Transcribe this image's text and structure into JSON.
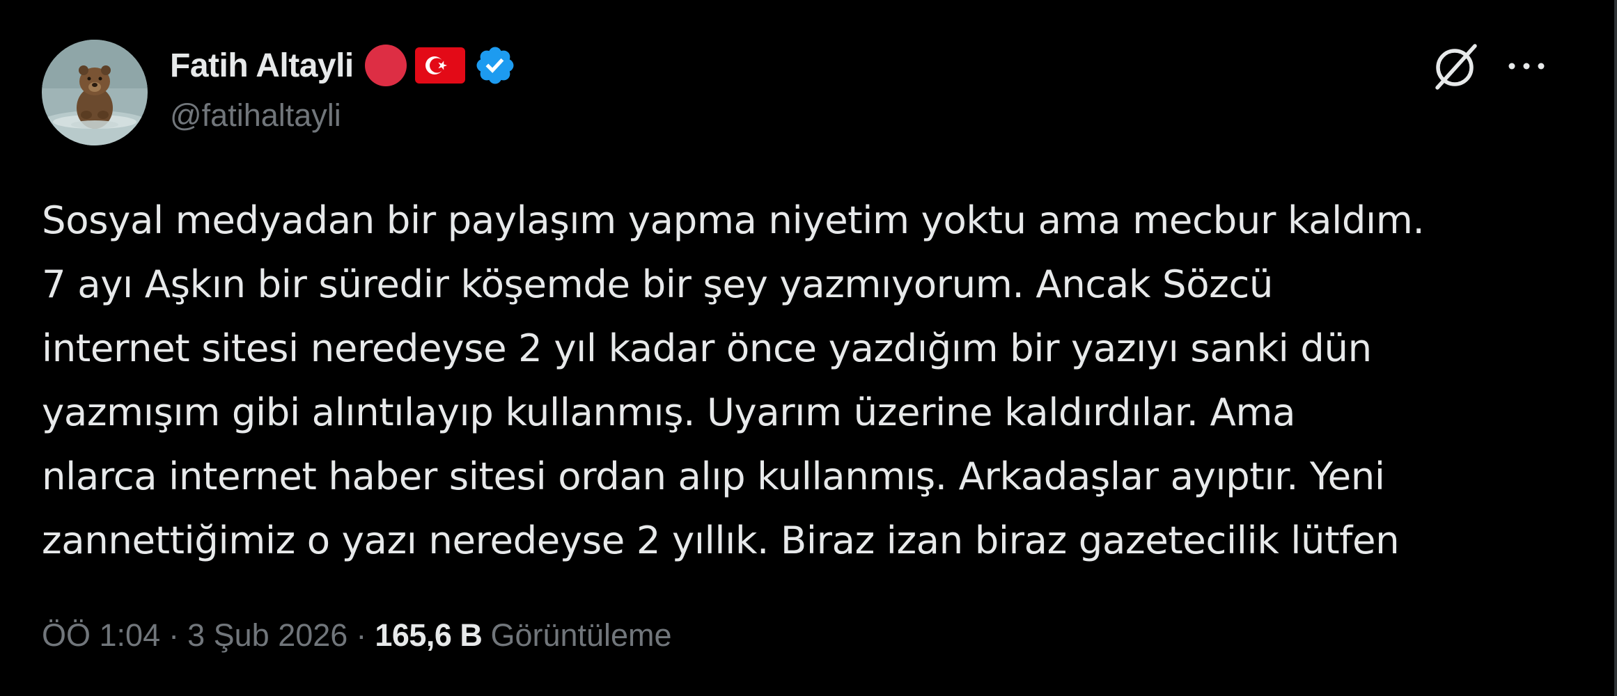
{
  "author": {
    "display_name": "Fatih Altayli",
    "handle": "@fatihaltayli",
    "avatar_alt": "bear-in-water avatar",
    "badges": [
      "red-circle-emoji",
      "turkey-flag-emoji",
      "verified-badge-icon"
    ]
  },
  "actions": {
    "grok_icon": "grok-icon",
    "more_icon": "more-options-icon"
  },
  "tweet": {
    "text": "Sosyal medyadan bir paylaşım yapma niyetim yoktu ama mecbur kaldım.\n7 ayı Aşkın bir süredir köşemde bir şey yazmıyorum. Ancak Sözcü\ninternet sitesi neredeyse 2 yıl kadar önce yazdığım bir yazıyı sanki dün\nyazmışım gibi alıntılayıp kullanmış.  Uyarım üzerine kaldırdılar. Ama\nnlarca internet haber sitesi ordan alıp kullanmış. Arkadaşlar ayıptır. Yeni\nzannettiğimiz o yazı neredeyse 2 yıllık. Biraz izan biraz gazetecilik lütfen"
  },
  "meta": {
    "time": "ÖÖ 1:04",
    "separator": "·",
    "date": "3 Şub 2026",
    "views_count": "165,6 B",
    "views_label": "Görüntüleme"
  },
  "colors": {
    "background": "#000000",
    "primary_text": "#e7e9ea",
    "secondary_text": "#71767b",
    "verified_blue": "#1d9bf0",
    "flag_red": "#e30a17",
    "emoji_red": "#dd2e44"
  }
}
